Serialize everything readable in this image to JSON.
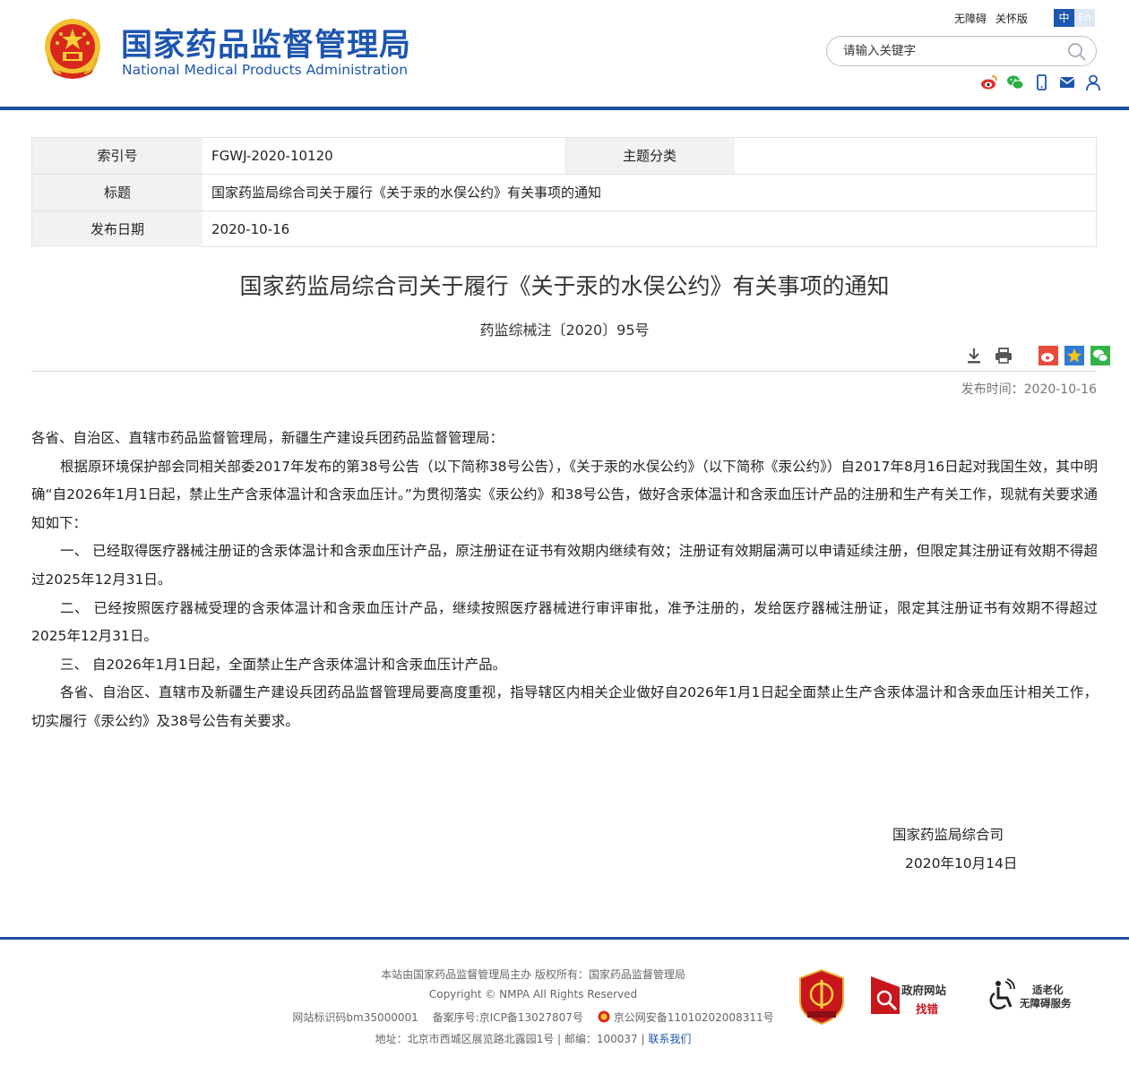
{
  "header": {
    "logo_cn": "国家药品监督管理局",
    "logo_en": "National Medical Products Administration",
    "top_links": [
      "无障碍",
      "关怀版"
    ],
    "lang_zh": "中",
    "lang_en": "En",
    "search_placeholder": "请输入关键字",
    "brand_color": "#1d56b0"
  },
  "info_table": {
    "index_label": "索引号",
    "index_value": "FGWJ-2020-10120",
    "topic_label": "主题分类",
    "topic_value": "",
    "title_label": "标题",
    "title_value": "国家药监局综合司关于履行《关于汞的水俣公约》有关事项的通知",
    "date_label": "发布日期",
    "date_value": "2020-10-16"
  },
  "article": {
    "title": "国家药监局综合司关于履行《关于汞的水俣公约》有关事项的通知",
    "doc_number": "药监综械注〔2020〕95号",
    "pub_time_label": "发布时间：",
    "pub_time": "2020-10-16",
    "paragraphs": [
      "各省、自治区、直辖市药品监督管理局，新疆生产建设兵团药品监督管理局：",
      "根据原环境保护部会同相关部委2017年发布的第38号公告（以下简称38号公告），《关于汞的水俣公约》（以下简称《汞公约》）自2017年8月16日起对我国生效，其中明确“自2026年1月1日起，禁止生产含汞体温计和含汞血压计。”为贯彻落实《汞公约》和38号公告，做好含汞体温计和含汞血压计产品的注册和生产有关工作，现就有关要求通知如下：",
      "一、 已经取得医疗器械注册证的含汞体温计和含汞血压计产品，原注册证在证书有效期内继续有效；注册证有效期届满可以申请延续注册，但限定其注册证有效期不得超过2025年12月31日。",
      "二、 已经按照医疗器械受理的含汞体温计和含汞血压计产品，继续按照医疗器械进行审评审批，准予注册的，发给医疗器械注册证，限定其注册证书有效期不得超过2025年12月31日。",
      "三、 自2026年1月1日起，全面禁止生产含汞体温计和含汞血压计产品。",
      "各省、自治区、直辖市及新疆生产建设兵团药品监督管理局要高度重视，指导辖区内相关企业做好自2026年1月1日起全面禁止生产含汞体温计和含汞血压计相关工作，切实履行《汞公约》及38号公告有关要求。"
    ],
    "signer": "国家药监局综合司",
    "sign_date": "2020年10月14日"
  },
  "footer": {
    "line1": "本站由国家药品监督管理局主办 版权所有：国家药品监督管理局",
    "line2": "Copyright © NMPA All Rights Reserved",
    "site_id": "网站标识码bm35000001",
    "icp": "备案序号:京ICP备13027807号",
    "police": "京公网安备11010202008311号",
    "address": "地址：北京市西城区展览路北露园1号 | 邮编：100037 |",
    "contact": "联系我们",
    "gov_badge_t1": "政府网站",
    "gov_badge_t2": "找错",
    "acc_badge_t1": "适老化",
    "acc_badge_t2": "无障碍服务"
  }
}
